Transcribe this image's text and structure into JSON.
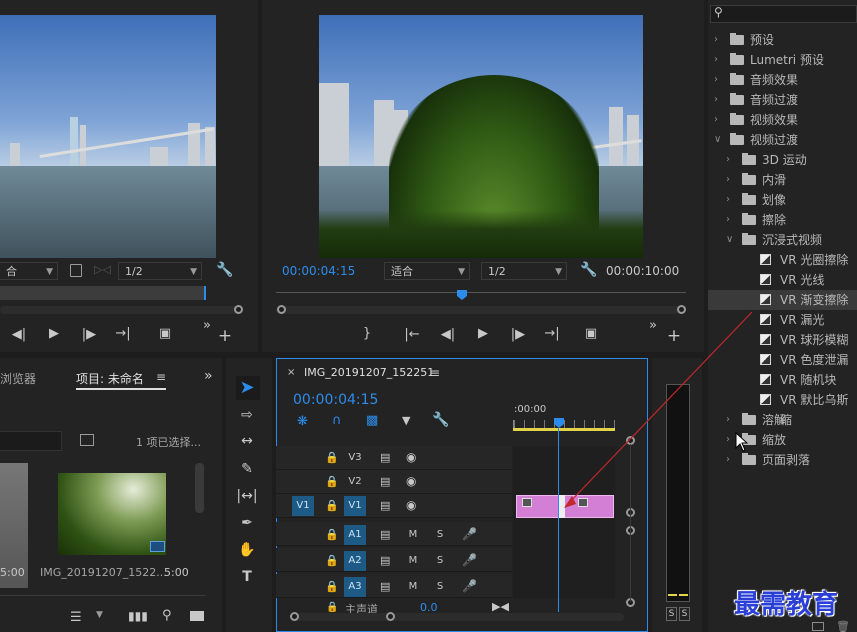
{
  "source_monitor": {
    "fit_value": "合",
    "quality_value": "1/2"
  },
  "program_monitor": {
    "timecode": "00:00:04:15",
    "fit_value": "适合",
    "quality_value": "1/2",
    "duration": "00:00:10:00"
  },
  "project_panel": {
    "tab_media_browser": "浏览器",
    "tab_project": "项目: 未命名",
    "selection_info": "1 项已选择...",
    "clip_name": "IMG_20191207_1522...",
    "clip_duration": "5:00",
    "left_clip_duration": "5:00"
  },
  "timeline": {
    "sequence_name": "IMG_20191207_152251",
    "timecode": "00:00:04:15",
    "ruler_start": ":00:00",
    "tracks": [
      {
        "src": "",
        "name": "V3",
        "btn2": "",
        "btn3": ""
      },
      {
        "src": "",
        "name": "V2",
        "btn2": "",
        "btn3": ""
      },
      {
        "src": "V1",
        "name": "V1",
        "btn2": "",
        "btn3": ""
      },
      {
        "src": "",
        "name": "A1",
        "btn2": "M",
        "btn3": "S"
      },
      {
        "src": "",
        "name": "A2",
        "btn2": "M",
        "btn3": "S"
      },
      {
        "src": "",
        "name": "A3",
        "btn2": "M",
        "btn3": "S"
      }
    ],
    "master_label": "主声道",
    "master_value": "0.0"
  },
  "audio_meter": {
    "solo_left": "S",
    "solo_right": "S"
  },
  "effects_panel": {
    "items": [
      {
        "level": 0,
        "expanded": false,
        "type": "bin",
        "label": "预设"
      },
      {
        "level": 0,
        "expanded": false,
        "type": "bin",
        "label": "Lumetri 预设"
      },
      {
        "level": 0,
        "expanded": false,
        "type": "folder",
        "label": "音频效果"
      },
      {
        "level": 0,
        "expanded": false,
        "type": "folder",
        "label": "音频过渡"
      },
      {
        "level": 0,
        "expanded": false,
        "type": "folder",
        "label": "视频效果"
      },
      {
        "level": 0,
        "expanded": true,
        "type": "folder",
        "label": "视频过渡"
      },
      {
        "level": 1,
        "expanded": false,
        "type": "folder",
        "label": "3D 运动"
      },
      {
        "level": 1,
        "expanded": false,
        "type": "folder",
        "label": "内滑"
      },
      {
        "level": 1,
        "expanded": false,
        "type": "folder",
        "label": "划像"
      },
      {
        "level": 1,
        "expanded": false,
        "type": "folder",
        "label": "擦除"
      },
      {
        "level": 1,
        "expanded": true,
        "type": "folder",
        "label": "沉浸式视频"
      },
      {
        "level": 2,
        "type": "preset",
        "label": "VR 光圈擦除"
      },
      {
        "level": 2,
        "type": "preset",
        "label": "VR 光线"
      },
      {
        "level": 2,
        "type": "preset",
        "label": "VR 渐变擦除",
        "selected": true
      },
      {
        "level": 2,
        "type": "preset",
        "label": "VR 漏光"
      },
      {
        "level": 2,
        "type": "preset",
        "label": "VR 球形模糊"
      },
      {
        "level": 2,
        "type": "preset",
        "label": "VR 色度泄漏"
      },
      {
        "level": 2,
        "type": "preset",
        "label": "VR 随机块"
      },
      {
        "level": 2,
        "type": "preset",
        "label": "VR 默比乌斯缩"
      },
      {
        "level": 1,
        "expanded": false,
        "type": "folder",
        "label": "溶解"
      },
      {
        "level": 1,
        "expanded": false,
        "type": "folder",
        "label": "缩放"
      },
      {
        "level": 1,
        "expanded": false,
        "type": "folder",
        "label": "页面剥落"
      }
    ]
  },
  "watermark": "最需教育",
  "colors": {
    "accent_blue": "#2d8ceb",
    "clip_pink": "#d47fd6",
    "work_area_yellow": "#e3d34a",
    "drag_line_red": "#c0282b"
  }
}
